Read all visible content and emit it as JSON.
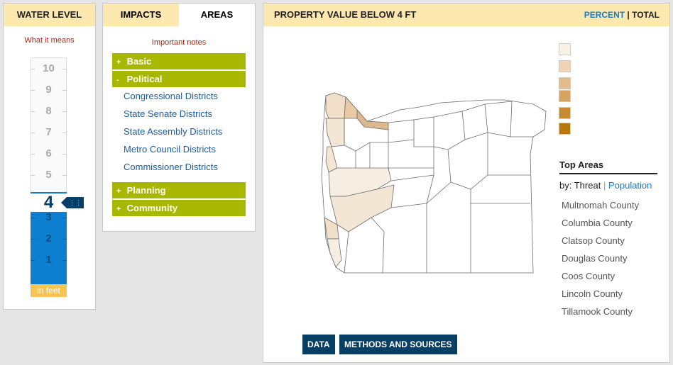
{
  "water": {
    "title": "Water Level",
    "link": "What it means",
    "ticks": [
      "10",
      "9",
      "8",
      "7",
      "6",
      "5",
      "4",
      "3",
      "2",
      "1"
    ],
    "level": "4",
    "grip_icon": "grip-icon",
    "unit_label": "in feet",
    "fill_color": "#0c7fd0"
  },
  "areas": {
    "tabs": [
      {
        "label": "Impacts",
        "active": false
      },
      {
        "label": "Areas",
        "active": true
      }
    ],
    "notes_link": "Important notes",
    "groups": [
      {
        "sign": "+",
        "label": "Basic"
      },
      {
        "sign": "-",
        "label": "Political",
        "items": [
          "Congressional Districts",
          "State Senate Districts",
          "State Assembly Districts",
          "Metro Council Districts",
          "Commissioner Districts"
        ]
      },
      {
        "sign": "+",
        "label": "Planning"
      },
      {
        "sign": "+",
        "label": "Community"
      }
    ],
    "accent_color": "#a8b800"
  },
  "property": {
    "title": "Property value below 4 ft",
    "toggle": {
      "percent": "PERCENT",
      "separator": "|",
      "total": "TOTAL"
    },
    "legend_colors": [
      "#f9f0e6",
      "#efd3b4",
      "#e3bb8a",
      "#d6a462",
      "#c58b32",
      "#b6780a"
    ],
    "top_areas_title": "Top Areas",
    "by_label": "by:",
    "by_options": {
      "threat": "Threat",
      "pipe": "|",
      "population": "Population"
    },
    "top_areas": [
      "Multnomah County",
      "Columbia County",
      "Clatsop County",
      "Douglas County",
      "Coos County",
      "Lincoln County",
      "Tillamook County"
    ],
    "buttons": {
      "data": "DATA",
      "methods": "METHODS AND SOURCES"
    },
    "button_color": "#083f65"
  }
}
